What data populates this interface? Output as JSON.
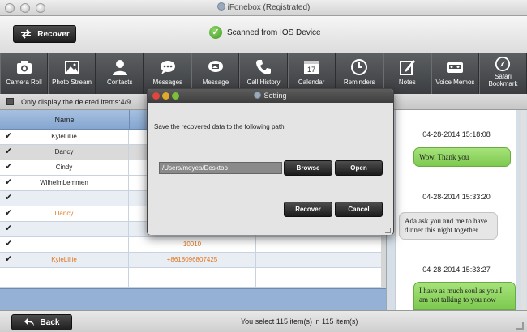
{
  "window": {
    "title": "iFonebox (Registrated)"
  },
  "top": {
    "recover_label": "Recover",
    "status_text": "Scanned from IOS Device"
  },
  "toolbar": {
    "items": [
      {
        "label": "Camera Roll",
        "icon": "camera-icon"
      },
      {
        "label": "Photo Stream",
        "icon": "photo-icon"
      },
      {
        "label": "Contacts",
        "icon": "person-icon"
      },
      {
        "label": "Messages",
        "icon": "chat-bubble-icon"
      },
      {
        "label": "Message",
        "icon": "message-attachment-icon"
      },
      {
        "label": "Call History",
        "icon": "phone-icon"
      },
      {
        "label": "Calendar",
        "icon": "calendar-icon"
      },
      {
        "label": "Reminders",
        "icon": "clock-icon"
      },
      {
        "label": "Notes",
        "icon": "note-pencil-icon"
      },
      {
        "label": "Voice Memos",
        "icon": "cassette-icon"
      },
      {
        "label": "Safari Bookmark",
        "icon": "compass-icon"
      }
    ],
    "calendar_day": "17"
  },
  "filter": {
    "label": "Only display the deleted items:4/9"
  },
  "table": {
    "header_name": "Name",
    "rows": [
      {
        "name": "KyleLillie",
        "number": "",
        "orange": false,
        "checked": true
      },
      {
        "name": "Dancy",
        "number": "",
        "orange": false,
        "checked": true
      },
      {
        "name": "Cindy",
        "number": "",
        "orange": false,
        "checked": true
      },
      {
        "name": "WilhelmLemmen",
        "number": "",
        "orange": false,
        "checked": true
      },
      {
        "name": "",
        "number": "",
        "orange": false,
        "checked": true
      },
      {
        "name": "Dancy",
        "number": "",
        "orange": true,
        "checked": true
      },
      {
        "name": "",
        "number": "",
        "orange": false,
        "checked": true
      },
      {
        "name": "",
        "number": "10010",
        "orange": true,
        "checked": true
      },
      {
        "name": "KyleLillie",
        "number": "+8618096807425",
        "orange": true,
        "checked": true
      }
    ]
  },
  "chat": {
    "timestamps": [
      "04-28-2014 15:18:08",
      "04-28-2014 15:33:20",
      "04-28-2014 15:33:27"
    ],
    "bubble1": "Wow. Thank you",
    "bubble2": "Ada ask you and me to have dinner this night together",
    "bubble3": "I have as much soul as you I am not talking to you now"
  },
  "footer": {
    "back_label": "Back",
    "summary": "You select 115 item(s) in 115 item(s)"
  },
  "dialog": {
    "title": "Setting",
    "message": "Save the recovered data to the following path.",
    "path_value": "/Users/moyea/Desktop",
    "browse_label": "Browse",
    "open_label": "Open",
    "recover_label": "Recover",
    "cancel_label": "Cancel"
  },
  "colors": {
    "orange": "#e0761e",
    "green_bubble": "#8fd45f",
    "toolbar": "#4a4d50"
  }
}
